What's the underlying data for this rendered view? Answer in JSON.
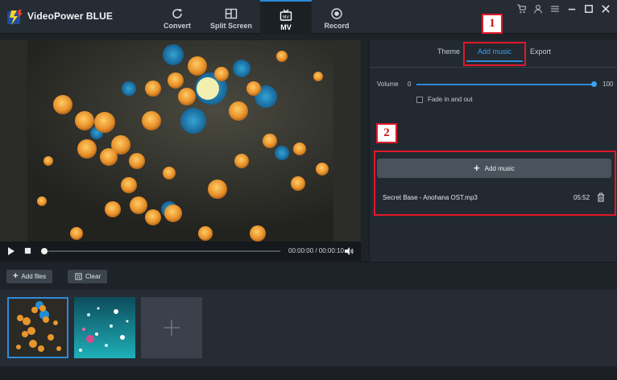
{
  "app": {
    "title": "VideoPower BLUE"
  },
  "nav_tabs": [
    {
      "label": "Convert",
      "icon": "refresh-icon"
    },
    {
      "label": "Split Screen",
      "icon": "split-screen-icon"
    },
    {
      "label": "MV",
      "icon": "tv-icon",
      "active": true
    },
    {
      "label": "Record",
      "icon": "record-icon"
    }
  ],
  "window_controls": [
    "cart-icon",
    "user-icon",
    "menu-icon",
    "minimize-icon",
    "maximize-icon",
    "close-icon"
  ],
  "player": {
    "time": "00:00:00 / 00:00:10",
    "progress": 0
  },
  "right_panel": {
    "tabs": [
      {
        "label": "Theme"
      },
      {
        "label": "Add music",
        "active": true
      },
      {
        "label": "Export"
      }
    ],
    "volume": {
      "label": "Volume",
      "min": "0",
      "max": "100",
      "value": 100
    },
    "fade": {
      "label": "Fade in and out",
      "checked": false
    },
    "add_music_button": "Add music",
    "music": [
      {
        "name": "Secret Base - Anohana OST.mp3",
        "duration": "05:52"
      }
    ]
  },
  "annotations": [
    {
      "label": "1"
    },
    {
      "label": "2"
    }
  ],
  "toolbar": {
    "add_files": "Add files",
    "clear": "Clear"
  },
  "colors": {
    "accent": "#2d8ad8",
    "highlight": "#e0192a",
    "bokeh": "#e8962c",
    "bokeh_blue": "#1e8fd6"
  }
}
